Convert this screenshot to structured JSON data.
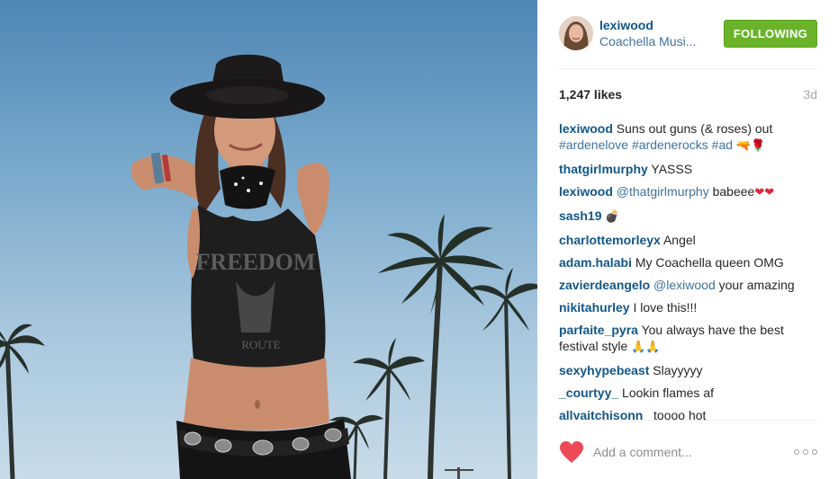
{
  "post": {
    "username": "lexiwood",
    "location": "Coachella Musi...",
    "follow_label": "FOLLOWING",
    "likes": "1,247 likes",
    "time_ago": "3d"
  },
  "comments": [
    {
      "user": "lexiwood",
      "parts": [
        {
          "t": "text",
          "v": "Suns out guns (& roses) out "
        },
        {
          "t": "link",
          "v": "#ardenelove"
        },
        {
          "t": "text",
          "v": " "
        },
        {
          "t": "link",
          "v": "#ardenerocks"
        },
        {
          "t": "text",
          "v": " "
        },
        {
          "t": "link",
          "v": "#ad"
        },
        {
          "t": "text",
          "v": " "
        },
        {
          "t": "emoji",
          "v": "🔫🌹"
        }
      ]
    },
    {
      "user": "thatgirlmurphy",
      "parts": [
        {
          "t": "text",
          "v": "YASSS"
        }
      ]
    },
    {
      "user": "lexiwood",
      "parts": [
        {
          "t": "link",
          "v": "@thatgirlmurphy"
        },
        {
          "t": "text",
          "v": " babeee"
        },
        {
          "t": "heart",
          "v": "❤❤"
        }
      ]
    },
    {
      "user": "sash19",
      "parts": [
        {
          "t": "emoji",
          "v": "💣"
        }
      ]
    },
    {
      "user": "charlottemorleyx",
      "parts": [
        {
          "t": "text",
          "v": "Angel"
        }
      ]
    },
    {
      "user": "adam.halabi",
      "parts": [
        {
          "t": "text",
          "v": "My Coachella queen OMG"
        }
      ]
    },
    {
      "user": "zavierdeangelo",
      "parts": [
        {
          "t": "link",
          "v": "@lexiwood"
        },
        {
          "t": "text",
          "v": " your amazing"
        }
      ]
    },
    {
      "user": "nikitahurley",
      "parts": [
        {
          "t": "text",
          "v": "I love this!!!"
        }
      ]
    },
    {
      "user": "parfaite_pyra",
      "parts": [
        {
          "t": "text",
          "v": "You always have the best festival style "
        },
        {
          "t": "emoji",
          "v": "🙏🙏"
        }
      ]
    },
    {
      "user": "sexyhypebeast",
      "parts": [
        {
          "t": "text",
          "v": "Slayyyyy"
        }
      ]
    },
    {
      "user": "_courtyy_",
      "parts": [
        {
          "t": "text",
          "v": "Lookin flames af"
        }
      ]
    },
    {
      "user": "allyaitchisonn_",
      "parts": [
        {
          "t": "text",
          "v": "toooo hot"
        }
      ]
    }
  ],
  "footer": {
    "comment_placeholder": "Add a comment...",
    "like_icon": "heart-icon",
    "more_icon": "more-options-icon",
    "like_color": "#ed4956"
  },
  "photo": {
    "shirt_print": "FREEDOM",
    "shirt_print_2": "ROUTE"
  },
  "colors": {
    "username": "#125688",
    "link": "#3f729b",
    "follow_bg": "#6bb42a",
    "sky_top": "#4f86b3"
  }
}
